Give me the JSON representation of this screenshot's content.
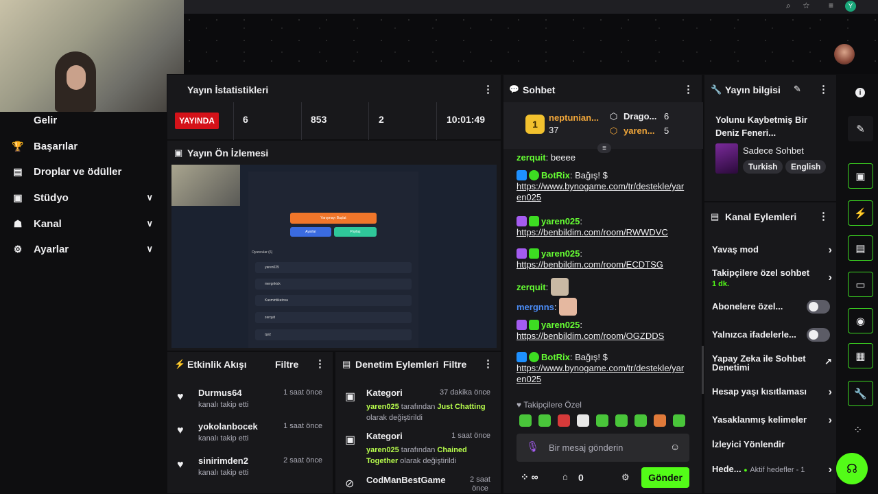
{
  "header": {
    "search_icon": "zoom-icon",
    "star_icon": "star-icon",
    "avatar_letter": "Y"
  },
  "sidebar": {
    "items": [
      {
        "label": "Gelir",
        "icon": "money-icon",
        "expandable": false
      },
      {
        "label": "Başarılar",
        "icon": "trophy-icon",
        "expandable": false
      },
      {
        "label": "Droplar ve ödüller",
        "icon": "gift-icon",
        "expandable": false
      },
      {
        "label": "Stüdyo",
        "icon": "studio-icon",
        "expandable": true
      },
      {
        "label": "Kanal",
        "icon": "channel-icon",
        "expandable": true
      },
      {
        "label": "Ayarlar",
        "icon": "gear-icon",
        "expandable": true
      }
    ]
  },
  "stats": {
    "title": "Yayın İstatistikleri",
    "live_label": "YAYINDA",
    "values": [
      "6",
      "853",
      "2",
      "10:01:49"
    ]
  },
  "preview": {
    "title": "Yayın Ön İzlemesi",
    "inner_start_button": "Yarışmayı Başlat",
    "inner_settings_button": "Ayarlar",
    "inner_share_button": "Paylaş",
    "inner_players_label": "Oyuncular (6)",
    "inner_players": [
      "yaren025",
      "mergnkick",
      "Kasmirtiikatova",
      "zerquit",
      "quiz"
    ]
  },
  "activity": {
    "title": "Etkinlik Akışı",
    "filter": "Filtre",
    "items": [
      {
        "name": "Durmus64",
        "sub": "kanalı takip etti",
        "time": "1 saat önce"
      },
      {
        "name": "yokolanbocek",
        "sub": "kanalı takip etti",
        "time": "1 saat önce"
      },
      {
        "name": "sinirimden2",
        "sub": "kanalı takip etti",
        "time": "2 saat önce"
      }
    ]
  },
  "moderation": {
    "title": "Denetim Eylemleri",
    "filter": "Filtre",
    "items": [
      {
        "name": "Kategori",
        "time": "37 dakika önce",
        "user": "yaren025",
        "mid": " tarafından ",
        "target": "Just Chatting",
        "tail": " olarak değiştirildi"
      },
      {
        "name": "Kategori",
        "time": "1 saat önce",
        "user": "yaren025",
        "mid": " tarafından ",
        "target": "Chained Together",
        "tail": " olarak değiştirildi"
      },
      {
        "name": "CodManBestGame",
        "time": "2 saat önce"
      }
    ]
  },
  "chat": {
    "title": "Sohbet",
    "leader1_name": "neptunian...",
    "leader1_rank": "1",
    "leader1_count": "37",
    "leader2_name": "Drago...",
    "leader2_count": "6",
    "leader3_name": "yaren...",
    "leader3_count": "5",
    "lines": [
      {
        "user": "zerquit",
        "text": "beeee"
      },
      {
        "user": "BotRix",
        "text": "Bağış! $",
        "link": "https://www.bynogame.com/tr/destekle/yaren025"
      },
      {
        "user": "yaren025",
        "text": "",
        "link": "https://benbildim.com/room/RWWDVC"
      },
      {
        "user": "yaren025",
        "text": "",
        "link": "https://benbildim.com/room/ECDTSG"
      },
      {
        "user": "zerquit",
        "text": ""
      },
      {
        "user": "mergnns",
        "text": ""
      },
      {
        "user": "yaren025",
        "text": "",
        "link": "https://benbildim.com/room/OGZDDS"
      },
      {
        "user": "BotRix",
        "text": "Bağış! $",
        "link": "https://www.bynogame.com/tr/destekle/yaren025"
      }
    ],
    "followers_only": "Takipçilere Özel",
    "input_placeholder": "Bir mesaj gönderin",
    "points": "0",
    "send_label": "Gönder"
  },
  "stream_info": {
    "title": "Yayın bilgisi",
    "stream_title": "Yolunu Kaybetmiş Bir Deniz Feneri...",
    "category": "Sadece Sohbet",
    "tags": [
      "Turkish",
      "English"
    ]
  },
  "channel_actions": {
    "title": "Kanal Eylemleri",
    "items": [
      {
        "label": "Yavaş mod",
        "control": "arrow"
      },
      {
        "label": "Takipçilere özel sohbet",
        "sub": "1 dk.",
        "control": "arrow"
      },
      {
        "label": "Abonelere özel...",
        "control": "toggle"
      },
      {
        "label": "Yalnızca ifadelerle...",
        "control": "toggle"
      },
      {
        "label": "Yapay Zeka ile Sohbet Denetimi",
        "control": "external"
      },
      {
        "label": "Hesap yaşı kısıtlaması",
        "control": "arrow"
      },
      {
        "label": "Yasaklanmış kelimeler",
        "control": "arrow"
      },
      {
        "label": "İzleyici Yönlendir",
        "control": "none"
      },
      {
        "label": "Hede...",
        "sub": "Aktif hedefler - 1",
        "control": "arrow"
      }
    ]
  },
  "colors": {
    "accent": "#66ff33",
    "live": "#d41219",
    "panel": "#18181b",
    "background": "#0e0e10"
  }
}
